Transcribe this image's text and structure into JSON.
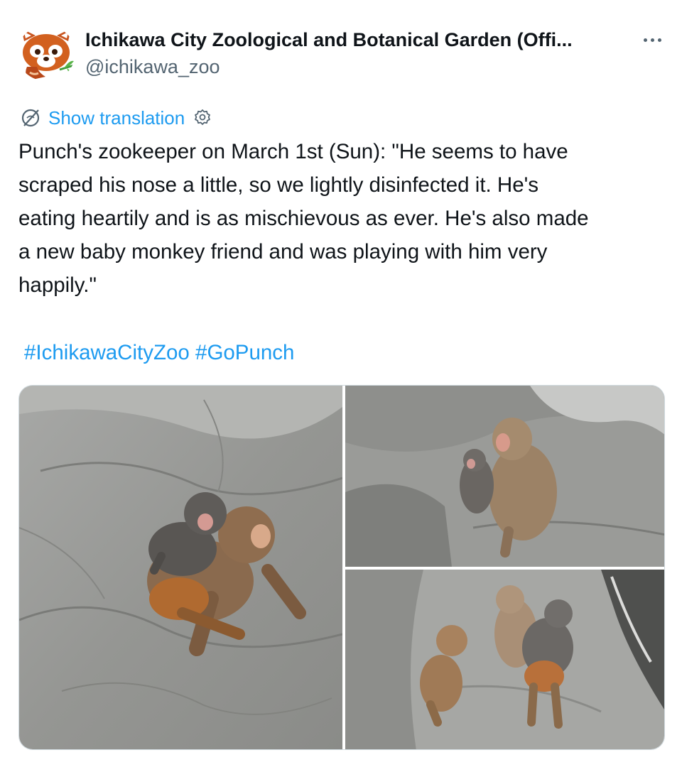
{
  "account": {
    "display_name": "Ichikawa City Zoological and Botanical Garden (Offi...",
    "handle": "@ichikawa_zoo",
    "avatar_icon": "red-panda-icon"
  },
  "more_icon": "more-dots-icon",
  "translation": {
    "label": "Show translation",
    "globe_icon": "translate-globe-icon",
    "settings_icon": "gear-icon"
  },
  "tweet": {
    "text": "Punch's zookeeper on March 1st (Sun): \"He seems to have\nscraped his nose a little, so we lightly disinfected it. He's\neating heartily and is as mischievous as ever. He's also made\na new baby monkey friend and was playing with him very\nhappily.\"",
    "hashtags": [
      "#IchikawaCityZoo",
      "#GoPunch"
    ]
  },
  "colors": {
    "text": "#0f1419",
    "secondary": "#536471",
    "link": "#1d9bf0",
    "border": "#cfd9de"
  }
}
